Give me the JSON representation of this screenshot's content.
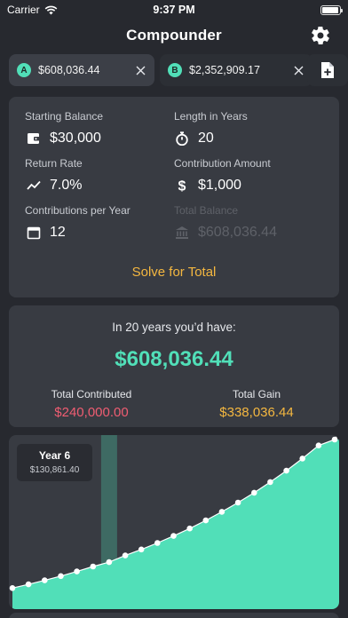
{
  "status_bar": {
    "carrier": "Carrier",
    "time": "9:37 PM",
    "battery_fill": 0.95
  },
  "nav": {
    "title": "Compounder",
    "settings_icon": "gear-icon"
  },
  "tabs": [
    {
      "letter": "A",
      "value": "$608,036.44",
      "selected": true
    },
    {
      "letter": "B",
      "value": "$2,352,909.17",
      "selected": false
    }
  ],
  "add_tab_icon": "add-document-icon",
  "inputs": {
    "starting_balance": {
      "label": "Starting Balance",
      "value": "$30,000",
      "icon": "wallet-icon"
    },
    "length_years": {
      "label": "Length in Years",
      "value": "20",
      "icon": "stopwatch-icon"
    },
    "return_rate": {
      "label": "Return Rate",
      "value": "7.0%",
      "icon": "trend-line-icon"
    },
    "contribution_amount": {
      "label": "Contribution Amount",
      "value": "$1,000",
      "icon": "dollar-icon"
    },
    "contributions_per_year": {
      "label": "Contributions per Year",
      "value": "12",
      "icon": "calendar-icon"
    },
    "total_balance": {
      "label": "Total Balance",
      "value": "$608,036.44",
      "icon": "bank-icon"
    }
  },
  "solve_label": "Solve for Total",
  "result": {
    "heading": "In 20 years you’d have:",
    "total": "$608,036.44",
    "contributed_label": "Total Contributed",
    "contributed_value": "$240,000.00",
    "gain_label": "Total Gain",
    "gain_value": "$338,036.44"
  },
  "colors": {
    "accent": "#51dfb8",
    "contributed": "#ef5d72",
    "gain": "#f4b740",
    "panel": "#383b42",
    "background": "#27292f"
  },
  "chart_data": {
    "type": "area",
    "x": [
      0,
      1,
      2,
      3,
      4,
      5,
      6,
      7,
      8,
      9,
      10,
      11,
      12,
      13,
      14,
      15,
      16,
      17,
      18,
      19,
      20
    ],
    "values": [
      30000,
      44525,
      60099,
      76799,
      94705,
      113906,
      130861,
      156700,
      180328,
      205662,
      232829,
      261959,
      293194,
      326686,
      362599,
      401108,
      442400,
      486676,
      534152,
      585058,
      608036
    ],
    "highlighted_year": 6,
    "tooltip": {
      "label": "Year 6",
      "value": "$130,861.40"
    },
    "ylim": [
      0,
      608036
    ]
  }
}
